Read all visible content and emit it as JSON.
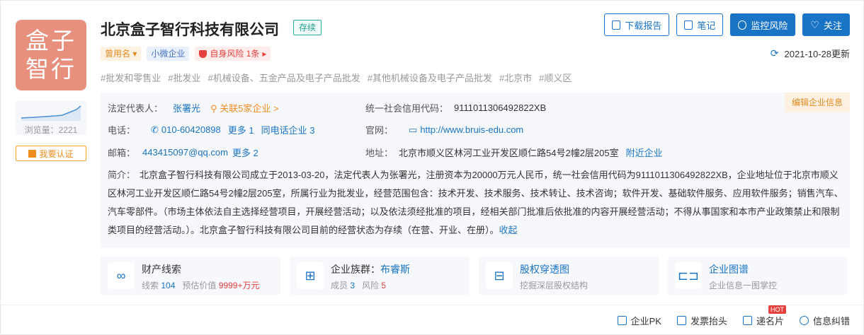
{
  "logo": {
    "line1": "盒子",
    "line2": "智行",
    "color": "#e8907e"
  },
  "views": {
    "label": "浏览量：",
    "value": "2221"
  },
  "auth": {
    "label": "我要认证"
  },
  "company": {
    "name": "北京盒子智行科技有限公司",
    "status": "存续"
  },
  "tags": {
    "alias": "曾用名",
    "size": "小微企业",
    "risk": "自身风险 1条"
  },
  "industry_tags": [
    "#批发和零售业",
    "#批发业",
    "#机械设备、五金产品及电子产品批发",
    "#其他机械设备及电子产品批发",
    "#北京市",
    "#顺义区"
  ],
  "buttons": {
    "download": "下载报告",
    "notes": "笔记",
    "monitor": "监控风险",
    "follow": "关注"
  },
  "updated": "2021-10-28更新",
  "info": {
    "edit": "编辑企业信息",
    "legal_rep_label": "法定代表人：",
    "legal_rep": "张署光",
    "related": "关联5家企业 >",
    "credit_label": "统一社会信用代码：",
    "credit": "9111011306492822XB",
    "phone_label": "电话：",
    "phone": "010-60420898",
    "phone_more": "更多 1",
    "phone_same": "同电话企业 3",
    "site_label": "官网：",
    "site": "http://www.bruis-edu.com",
    "email_label": "邮箱：",
    "email": "443415097@qq.com",
    "email_more": "更多 2",
    "address_label": "地址：",
    "address": "北京市顺义区林河工业开发区顺仁路54号2幢2层205室",
    "nearby": "附近企业",
    "summary_label": "简介：",
    "summary": "北京盒子智行科技有限公司成立于2013-03-20，法定代表人为张署光，注册资本为20000万元人民币，统一社会信用代码为9111011306492822XB，企业地址位于北京市顺义区林河工业开发区顺仁路54号2幢2层205室，所属行业为批发业，经营范围包含：技术开发、技术服务、技术转让、技术咨询；软件开发、基础软件服务、应用软件服务；销售汽车、汽车零部件。（市场主体依法自主选择经营项目，开展经营活动；以及依法须经批准的项目，经相关部门批准后依批准的内容开展经营活动；不得从事国家和本市产业政策禁止和限制类项目的经营活动。）。北京盒子智行科技有限公司目前的经营状态为存续（在营、开业、在册）。",
    "collapse": "收起"
  },
  "cards": {
    "asset": {
      "title": "财产线索",
      "k1": "线索",
      "v1": "104",
      "k2": "预估价值",
      "v2": "9999+万元"
    },
    "group": {
      "title": "企业族群：",
      "name": "布睿斯",
      "k1": "成员",
      "v1": "3",
      "k2": "风险",
      "v2": "5"
    },
    "equity": {
      "title": "股权穿透图",
      "sub": "挖掘深层股权结构"
    },
    "graph": {
      "title": "企业图谱",
      "sub": "企业信息一图掌控"
    }
  },
  "bottom": {
    "pk": "企业PK",
    "invoice": "发票抬头",
    "card": "递名片",
    "hot": "HOT",
    "correct": "信息纠错"
  }
}
